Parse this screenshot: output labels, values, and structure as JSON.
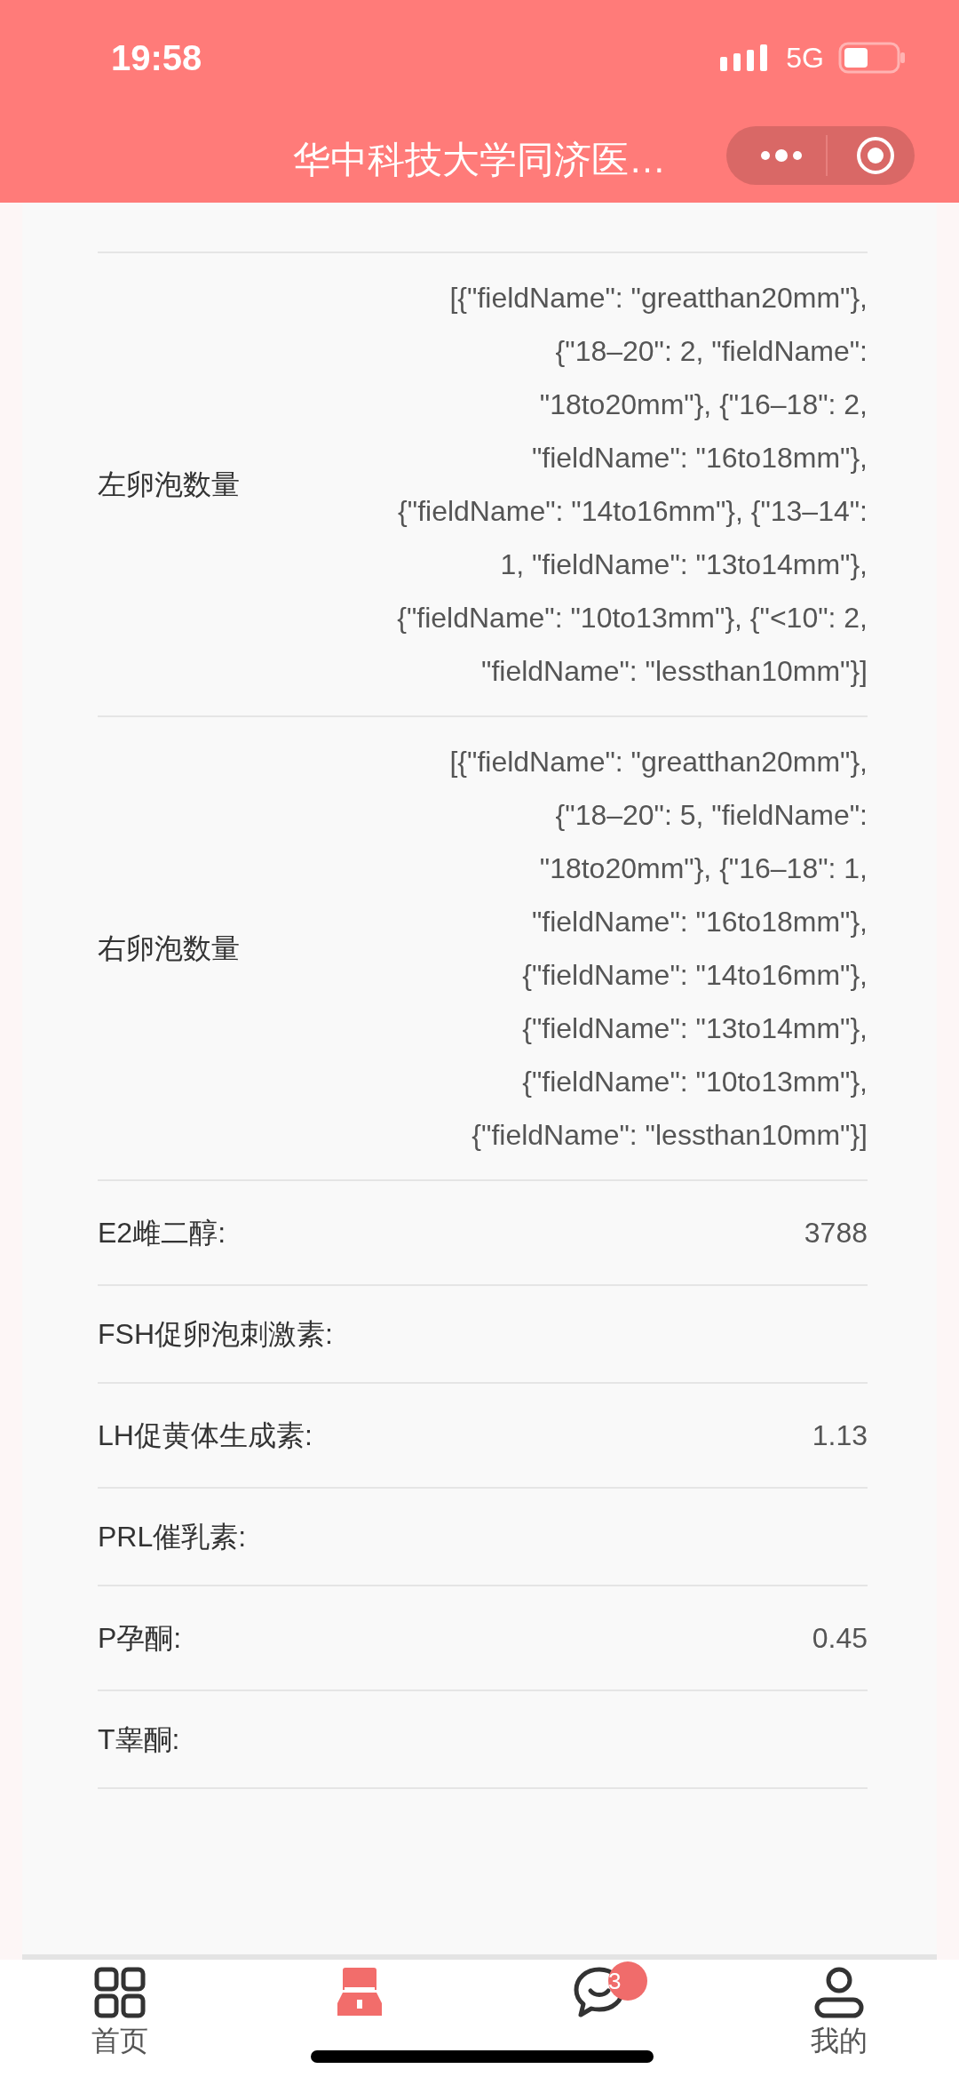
{
  "status_bar": {
    "time": "19:58",
    "network": "5G"
  },
  "title_bar": {
    "title": "华中科技大学同济医…"
  },
  "rows": [
    {
      "label": "左卵泡数量",
      "value": "[{\"fieldName\": \"greatthan20mm\"}, {\"18–20\": 2, \"fieldName\": \"18to20mm\"}, {\"16–18\": 2, \"fieldName\": \"16to18mm\"}, {\"fieldName\": \"14to16mm\"}, {\"13–14\": 1, \"fieldName\": \"13to14mm\"}, {\"fieldName\": \"10to13mm\"}, {\"<10\": 2, \"fieldName\": \"lessthan10mm\"}]"
    },
    {
      "label": "右卵泡数量",
      "value": "[{\"fieldName\": \"greatthan20mm\"}, {\"18–20\": 5, \"fieldName\": \"18to20mm\"}, {\"16–18\": 1, \"fieldName\": \"16to18mm\"}, {\"fieldName\": \"14to16mm\"}, {\"fieldName\": \"13to14mm\"}, {\"fieldName\": \"10to13mm\"}, {\"fieldName\": \"lessthan10mm\"}]"
    },
    {
      "label": "E2雌二醇:",
      "value": "3788"
    },
    {
      "label": "FSH促卵泡刺激素:"
    },
    {
      "label": "LH促黄体生成素:",
      "value": "1.13"
    },
    {
      "label": "PRL催乳素:"
    },
    {
      "label": "P孕酮:",
      "value": "0.45"
    },
    {
      "label": "T睾酮:"
    }
  ],
  "tabs": [
    {
      "kind": "grid",
      "label": "首页",
      "selected": false
    },
    {
      "kind": "guide",
      "selected": true
    },
    {
      "kind": "chat",
      "selected": false,
      "badge": "3"
    },
    {
      "kind": "person",
      "label": "我的",
      "selected": false
    }
  ]
}
